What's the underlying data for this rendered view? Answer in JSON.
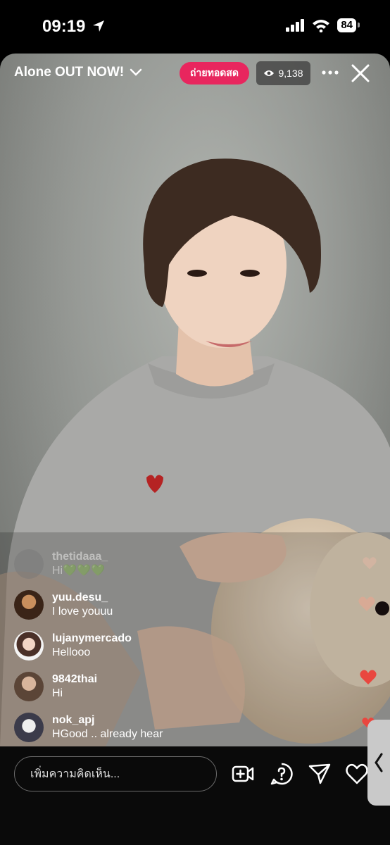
{
  "status_bar": {
    "time": "09:19",
    "battery": "84"
  },
  "live": {
    "title": "Alone OUT NOW!",
    "badge": "ถ่ายทอดสด",
    "viewers": "9,138"
  },
  "comments": [
    {
      "user": "thetidaaa_",
      "message": "Hi💚💚💚",
      "faded": true
    },
    {
      "user": "yuu.desu_",
      "message": "I love youuu"
    },
    {
      "user": "lujanymercado",
      "message": "Hellooo"
    },
    {
      "user": "9842thai",
      "message": "Hi"
    },
    {
      "user": "nok_apj",
      "message": "HGood .. already hear"
    }
  ],
  "composer": {
    "placeholder": "เพิ่มความคิดเห็น..."
  },
  "icons": [
    "location-arrow-icon",
    "signal-icon",
    "wifi-icon",
    "chevron-down-icon",
    "eye-icon",
    "more-icon",
    "close-icon",
    "add-video-icon",
    "question-icon",
    "send-icon",
    "heart-icon",
    "chevron-left-icon"
  ],
  "colors": {
    "live_badge": "#e8265e",
    "heart": "#e9473f",
    "background": "#000000"
  }
}
